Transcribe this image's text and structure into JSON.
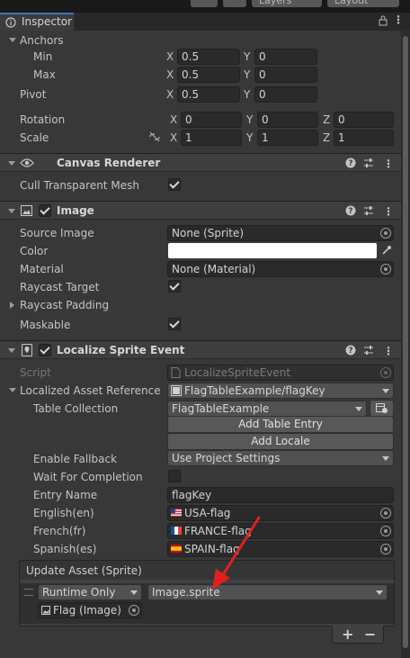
{
  "toolbar": {
    "layers_label": "Layers",
    "layout_label": "Layout"
  },
  "tab": {
    "title": "Inspector"
  },
  "rect_transform": {
    "anchors_label": "Anchors",
    "min_label": "Min",
    "max_label": "Max",
    "pivot_label": "Pivot",
    "rotation_label": "Rotation",
    "scale_label": "Scale",
    "x": "X",
    "y": "Y",
    "z": "Z",
    "min_x": "0.5",
    "min_y": "0",
    "max_x": "0.5",
    "max_y": "0",
    "pivot_x": "0.5",
    "pivot_y": "0",
    "rot_x": "0",
    "rot_y": "0",
    "rot_z": "0",
    "scale_x": "1",
    "scale_y": "1",
    "scale_z": "1"
  },
  "canvas_renderer": {
    "title": "Canvas Renderer",
    "cull_label": "Cull Transparent Mesh",
    "cull_checked": true
  },
  "image": {
    "title": "Image",
    "enabled": true,
    "source_image_label": "Source Image",
    "source_image_value": "None (Sprite)",
    "color_label": "Color",
    "color_value": "#ffffff",
    "material_label": "Material",
    "material_value": "None (Material)",
    "raycast_target_label": "Raycast Target",
    "raycast_target_checked": true,
    "raycast_padding_label": "Raycast Padding",
    "maskable_label": "Maskable",
    "maskable_checked": true
  },
  "localize": {
    "title": "Localize Sprite Event",
    "enabled": true,
    "script_label": "Script",
    "script_value": "LocalizeSpriteEvent",
    "asset_ref_label": "Localized Asset Reference",
    "asset_ref_value": "FlagTableExample/flagKey",
    "table_collection_label": "Table Collection",
    "table_collection_value": "FlagTableExample",
    "add_table_entry": "Add Table Entry",
    "add_locale": "Add Locale",
    "enable_fallback_label": "Enable Fallback",
    "enable_fallback_value": "Use Project Settings",
    "wait_label": "Wait For Completion",
    "wait_checked": false,
    "entry_name_label": "Entry Name",
    "entry_name_value": "flagKey",
    "locales": [
      {
        "label": "English(en)",
        "value": "USA-flag"
      },
      {
        "label": "French(fr)",
        "value": "FRANCE-flag"
      },
      {
        "label": "Spanish(es)",
        "value": "SPAIN-flag"
      }
    ],
    "update_asset": {
      "title": "Update Asset (Sprite)",
      "runtime_value": "Runtime Only",
      "function_value": "Image.sprite",
      "target_value": "Flag (Image)",
      "plus": "+",
      "minus": "−"
    }
  },
  "colors": {
    "accent": "#3a79bb",
    "annotation_arrow": "#e02020"
  }
}
